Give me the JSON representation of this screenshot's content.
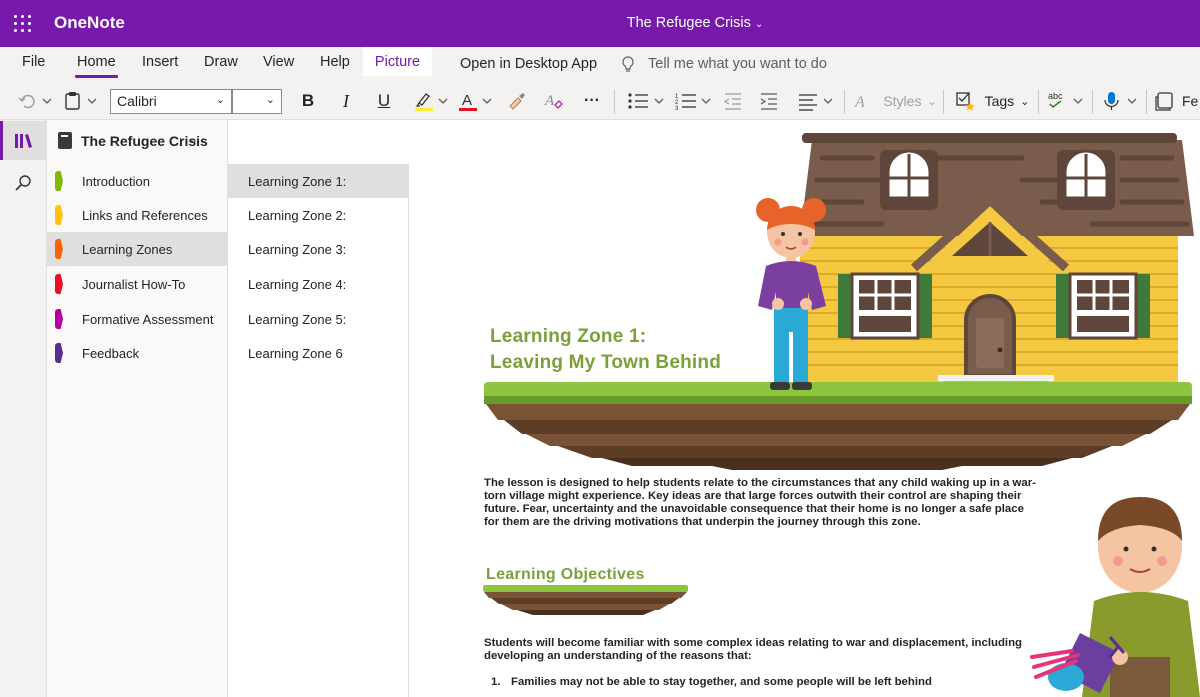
{
  "app": {
    "name": "OneNote",
    "document_title": "The Refugee Crisis"
  },
  "menu": {
    "items": [
      {
        "label": "File"
      },
      {
        "label": "Home"
      },
      {
        "label": "Insert"
      },
      {
        "label": "Draw"
      },
      {
        "label": "View"
      },
      {
        "label": "Help"
      },
      {
        "label": "Picture"
      }
    ],
    "active": "Home",
    "open_desktop": "Open in Desktop App",
    "tell_me": "Tell me what you want to do"
  },
  "toolbar": {
    "font_name": "Calibri",
    "font_size": "",
    "bold": "B",
    "italic": "I",
    "underline": "U",
    "font_color_letter": "A",
    "highlight_color": "#ffeb3b",
    "font_color": "#e81123",
    "more": "···",
    "styles_label": "Styles",
    "tags_label": "Tags",
    "spell_label": "abc",
    "feed_label": "Fe"
  },
  "notebook": {
    "name": "The Refugee Crisis"
  },
  "sections": [
    {
      "label": "Introduction",
      "color": "#7fba00"
    },
    {
      "label": "Links and References",
      "color": "#ffc20e"
    },
    {
      "label": "Learning Zones",
      "color": "#f7630c"
    },
    {
      "label": "Journalist How-To",
      "color": "#e81123"
    },
    {
      "label": "Formative Assessment",
      "color": "#b4009e"
    },
    {
      "label": "Feedback",
      "color": "#5c2d91"
    }
  ],
  "selected_section": "Learning Zones",
  "pages": [
    {
      "label": "Learning Zone 1:"
    },
    {
      "label": "Learning Zone 2:"
    },
    {
      "label": "Learning Zone 3:"
    },
    {
      "label": "Learning Zone 4:"
    },
    {
      "label": "Learning Zone 5:"
    },
    {
      "label": "Learning Zone 6"
    }
  ],
  "selected_page": "Learning Zone 1:",
  "content": {
    "title_line1": "Learning Zone 1:",
    "title_line2": "Leaving My Town Behind",
    "intro_lines": [
      "The lesson is designed to help students relate to the circumstances that any child waking up in a war-",
      "torn village might experience.  Key ideas are that large forces outwith their control are shaping their",
      "future.  Fear, uncertainty and the unavoidable consequence that their home is no longer a safe place",
      "for them are the driving motivations that underpin the journey through this zone."
    ],
    "objectives_title": "Learning  Objectives",
    "objectives_intro_lines": [
      "Students will become familiar with some complex ideas relating to war and displacement,  including",
      "developing an understanding of the reasons that:"
    ],
    "list": [
      {
        "num": "1.",
        "text": "Families may not be able to stay together, and some people will be left behind"
      }
    ]
  },
  "colors": {
    "brand_purple": "#7719aa",
    "heading_green": "#7ba03a"
  }
}
